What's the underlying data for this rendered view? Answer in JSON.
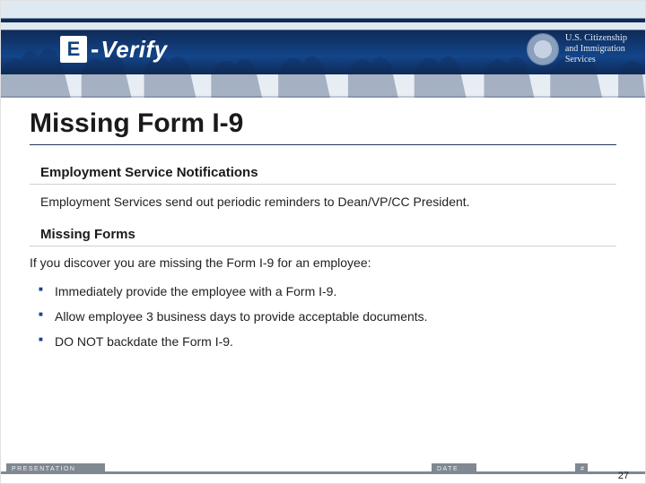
{
  "header": {
    "logo_letter": "E",
    "logo_dash": "-",
    "logo_word": "Verify",
    "agency_line1": "U.S. Citizenship",
    "agency_line2": "and Immigration",
    "agency_line3": "Services"
  },
  "title": "Missing Form I-9",
  "sections": [
    {
      "heading": "Employment Service Notifications",
      "body": "Employment Services send out periodic reminders to Dean/VP/CC President."
    },
    {
      "heading": "Missing Forms",
      "lead": "If you discover you are missing the Form I-9 for an employee:",
      "bullets": [
        "Immediately provide the employee with a Form I-9.",
        "Allow employee 3 business days to provide acceptable documents.",
        "DO NOT backdate the Form I-9."
      ]
    }
  ],
  "footer": {
    "presentation_label": "PRESENTATION",
    "date_label": "DATE",
    "number_label": "#",
    "page_number": "27"
  }
}
